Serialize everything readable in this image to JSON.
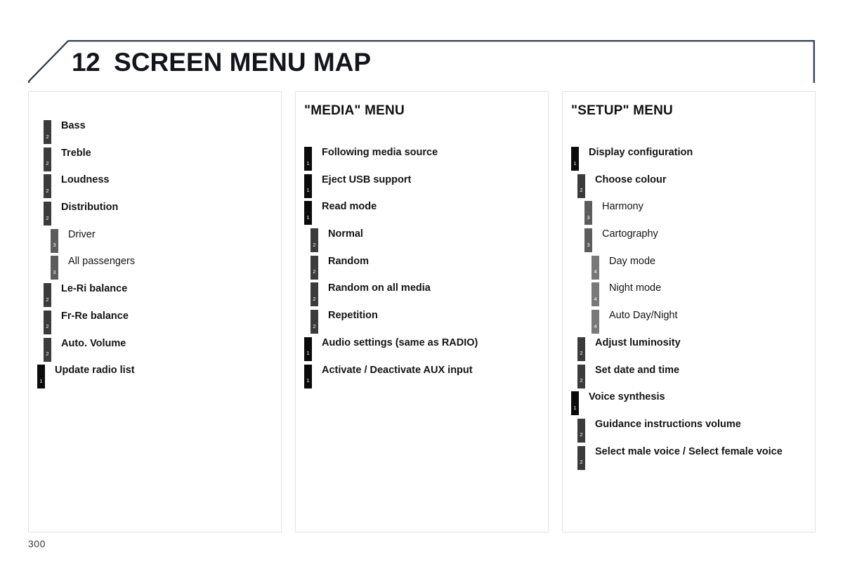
{
  "page": {
    "number": "300",
    "background_color": "#ffffff"
  },
  "banner": {
    "chapter_number": "12",
    "title": "SCREEN MENU MAP",
    "border_color": "#2b3648",
    "fill_color": "#ffffff"
  },
  "legend": {
    "level_colors": {
      "1": "#0b0b0b",
      "2": "#3b3b3b",
      "3": "#5c5c5c",
      "4": "#787878"
    }
  },
  "columns": [
    {
      "title": "",
      "has_title": false,
      "items": [
        {
          "level": 2,
          "label": "Bass"
        },
        {
          "level": 2,
          "label": "Treble"
        },
        {
          "level": 2,
          "label": "Loudness"
        },
        {
          "level": 2,
          "label": "Distribution"
        },
        {
          "level": 3,
          "label": "Driver"
        },
        {
          "level": 3,
          "label": "All passengers"
        },
        {
          "level": 2,
          "label": "Le-Ri balance"
        },
        {
          "level": 2,
          "label": "Fr-Re balance"
        },
        {
          "level": 2,
          "label": "Auto. Volume"
        },
        {
          "level": 1,
          "label": "Update radio list"
        }
      ]
    },
    {
      "title": "\"MEDIA\" MENU",
      "has_title": true,
      "items": [
        {
          "level": 1,
          "label": "Following media source"
        },
        {
          "level": 1,
          "label": "Eject USB support"
        },
        {
          "level": 1,
          "label": "Read mode"
        },
        {
          "level": 2,
          "label": "Normal"
        },
        {
          "level": 2,
          "label": "Random"
        },
        {
          "level": 2,
          "label": "Random on all media"
        },
        {
          "level": 2,
          "label": "Repetition"
        },
        {
          "level": 1,
          "label": "Audio settings (same as RADIO)"
        },
        {
          "level": 1,
          "label": "Activate / Deactivate AUX input"
        }
      ]
    },
    {
      "title": "\"SETUP\" MENU",
      "has_title": true,
      "items": [
        {
          "level": 1,
          "label": "Display configuration"
        },
        {
          "level": 2,
          "label": "Choose colour"
        },
        {
          "level": 3,
          "label": "Harmony"
        },
        {
          "level": 3,
          "label": "Cartography"
        },
        {
          "level": 4,
          "label": "Day mode"
        },
        {
          "level": 4,
          "label": "Night mode"
        },
        {
          "level": 4,
          "label": "Auto Day/Night"
        },
        {
          "level": 2,
          "label": "Adjust luminosity"
        },
        {
          "level": 2,
          "label": "Set date and time"
        },
        {
          "level": 1,
          "label": "Voice synthesis"
        },
        {
          "level": 2,
          "label": "Guidance instructions volume"
        },
        {
          "level": 2,
          "label": "Select male voice / Select female voice"
        }
      ]
    }
  ]
}
